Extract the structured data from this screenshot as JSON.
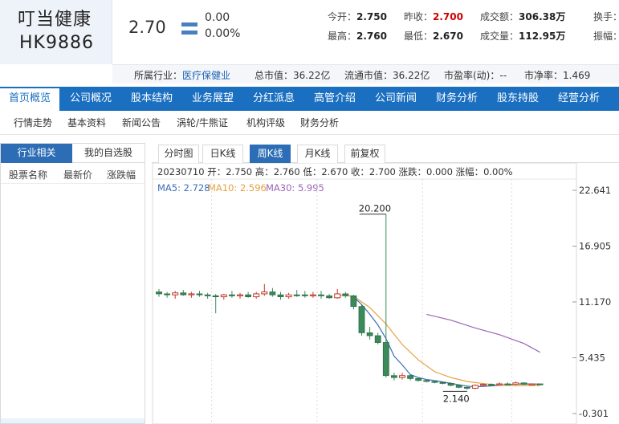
{
  "stock": {
    "name": "叮当健康",
    "code": "HK9886",
    "price": "2.70",
    "change": "0.00",
    "change_pct": "0.00%"
  },
  "quote": {
    "open_label": "今开：",
    "open": "2.750",
    "prev_close_label": "昨收：",
    "prev_close": "2.700",
    "turnover_label": "成交额：",
    "turnover": "306.38万",
    "turnover_rate_label": "换手：",
    "high_label": "最高：",
    "high": "2.760",
    "low_label": "最低：",
    "low": "2.670",
    "volume_label": "成交量：",
    "volume": "112.95万",
    "amplitude_label": "振幅："
  },
  "industry_bar": {
    "industry_label": "所属行业：",
    "industry": "医疗保健业",
    "total_cap": "总市值：36.22亿",
    "float_cap": "流通市值：36.22亿",
    "pe": "市盈率(动)：--",
    "pb": "市净率：1.469"
  },
  "main_nav": [
    "首页概览",
    "公司概况",
    "股本结构",
    "业务展望",
    "分红派息",
    "高管介绍",
    "公司新闻",
    "财务分析",
    "股东持股",
    "经营分析"
  ],
  "sub_nav": [
    "行情走势",
    "基本资料",
    "新闻公告",
    "涡轮/牛熊证",
    "机构评级",
    "财务分析"
  ],
  "sidebar": {
    "tab_industry": "行业相关",
    "tab_mine": "我的自选股",
    "col_name": "股票名称",
    "col_price": "最新价",
    "col_change": "涨跌幅"
  },
  "chart_tabs": [
    "分时图",
    "日K线",
    "周K线",
    "月K线",
    "前复权"
  ],
  "chart_info": {
    "info_line": "20230710 开：2.750 高：2.760 低：2.670 收：2.700 涨跌：0.000 涨幅：0.00%",
    "ma5_label": "MA5: 2.728",
    "ma10_label": "MA10: 2.596",
    "ma30_label": "MA30: 5.995"
  },
  "colors": {
    "up": "#c0392b",
    "down": "#3a8a5a",
    "ma5": "#3a6fb8",
    "ma10": "#e8a040",
    "ma30": "#9a66b8",
    "nav": "#1a6fc1"
  },
  "chart_data": {
    "type": "candlestick",
    "y_ticks": [
      "22.641",
      "16.905",
      "11.170",
      "5.435",
      "-0.301"
    ],
    "ylim": [
      -0.301,
      22.641
    ],
    "annotations": {
      "max": "20.200",
      "min": "2.140"
    },
    "candles": [
      [
        12.2,
        12.5,
        11.7,
        12.0
      ],
      [
        12.0,
        12.2,
        11.6,
        11.9
      ],
      [
        11.9,
        12.3,
        11.5,
        12.1
      ],
      [
        12.1,
        12.4,
        11.8,
        11.9
      ],
      [
        11.9,
        12.2,
        11.6,
        12.0
      ],
      [
        12.0,
        12.3,
        11.7,
        11.9
      ],
      [
        11.9,
        12.1,
        11.5,
        11.8
      ],
      [
        11.8,
        12.0,
        10.0,
        11.7
      ],
      [
        11.7,
        12.0,
        11.4,
        11.9
      ],
      [
        11.9,
        12.3,
        11.6,
        11.8
      ],
      [
        11.8,
        12.1,
        11.5,
        11.9
      ],
      [
        11.9,
        12.2,
        11.6,
        11.7
      ],
      [
        11.7,
        12.2,
        11.5,
        12.0
      ],
      [
        12.0,
        13.0,
        11.8,
        12.2
      ],
      [
        12.2,
        12.6,
        11.7,
        11.9
      ],
      [
        11.9,
        12.2,
        11.4,
        11.7
      ],
      [
        11.7,
        12.1,
        11.5,
        11.9
      ],
      [
        11.9,
        12.4,
        11.7,
        11.9
      ],
      [
        11.9,
        12.3,
        11.6,
        11.8
      ],
      [
        11.8,
        12.2,
        11.6,
        11.9
      ],
      [
        11.9,
        12.3,
        11.5,
        11.8
      ],
      [
        11.8,
        12.0,
        11.5,
        11.6
      ],
      [
        11.6,
        12.5,
        11.5,
        12.0
      ],
      [
        12.0,
        12.2,
        11.6,
        11.8
      ],
      [
        11.8,
        11.9,
        10.4,
        10.7
      ],
      [
        10.7,
        10.9,
        7.7,
        8.0
      ],
      [
        8.0,
        8.6,
        7.3,
        7.7
      ],
      [
        7.7,
        8.0,
        6.8,
        7.0
      ],
      [
        7.0,
        20.2,
        3.4,
        3.6
      ],
      [
        3.6,
        3.9,
        3.1,
        3.4
      ],
      [
        3.4,
        3.9,
        3.2,
        3.6
      ],
      [
        3.6,
        3.7,
        3.1,
        3.3
      ],
      [
        3.3,
        3.4,
        3.0,
        3.1
      ],
      [
        3.1,
        3.2,
        2.9,
        3.0
      ],
      [
        3.0,
        3.1,
        2.8,
        2.9
      ],
      [
        2.9,
        3.0,
        2.7,
        2.8
      ],
      [
        2.8,
        2.9,
        2.5,
        2.6
      ],
      [
        2.6,
        2.7,
        2.3,
        2.4
      ],
      [
        2.4,
        2.5,
        2.14,
        2.3
      ],
      [
        2.3,
        2.7,
        2.2,
        2.6
      ],
      [
        2.6,
        2.8,
        2.5,
        2.7
      ],
      [
        2.7,
        2.8,
        2.6,
        2.65
      ],
      [
        2.65,
        2.9,
        2.6,
        2.75
      ],
      [
        2.75,
        2.9,
        2.6,
        2.7
      ],
      [
        2.7,
        3.0,
        2.6,
        2.85
      ],
      [
        2.85,
        2.9,
        2.65,
        2.7
      ],
      [
        2.7,
        2.8,
        2.65,
        2.75
      ],
      [
        2.75,
        2.76,
        2.67,
        2.7
      ]
    ],
    "ma5": [
      [
        24,
        11.7
      ],
      [
        25,
        10.9
      ],
      [
        26,
        9.9
      ],
      [
        27,
        8.8
      ],
      [
        28,
        7.4
      ],
      [
        29,
        5.6
      ],
      [
        30,
        4.7
      ],
      [
        31,
        3.7
      ],
      [
        32,
        3.4
      ],
      [
        33,
        3.2
      ],
      [
        34,
        3.1
      ],
      [
        35,
        2.95
      ],
      [
        36,
        2.8
      ],
      [
        37,
        2.65
      ],
      [
        38,
        2.52
      ],
      [
        39,
        2.45
      ],
      [
        40,
        2.5
      ],
      [
        41,
        2.55
      ],
      [
        42,
        2.6
      ],
      [
        43,
        2.68
      ],
      [
        44,
        2.73
      ],
      [
        45,
        2.75
      ],
      [
        46,
        2.74
      ],
      [
        47,
        2.728
      ]
    ],
    "ma10": [
      [
        22,
        11.9
      ],
      [
        24,
        11.75
      ],
      [
        26,
        10.6
      ],
      [
        28,
        8.9
      ],
      [
        30,
        6.8
      ],
      [
        32,
        5.2
      ],
      [
        34,
        4.0
      ],
      [
        36,
        3.4
      ],
      [
        38,
        3.0
      ],
      [
        40,
        2.78
      ],
      [
        42,
        2.62
      ],
      [
        44,
        2.56
      ],
      [
        46,
        2.58
      ],
      [
        47,
        2.596
      ]
    ],
    "ma30": [
      [
        33,
        9.9
      ],
      [
        36,
        9.3
      ],
      [
        39,
        8.5
      ],
      [
        42,
        7.8
      ],
      [
        45,
        6.9
      ],
      [
        47,
        5.995
      ]
    ]
  }
}
